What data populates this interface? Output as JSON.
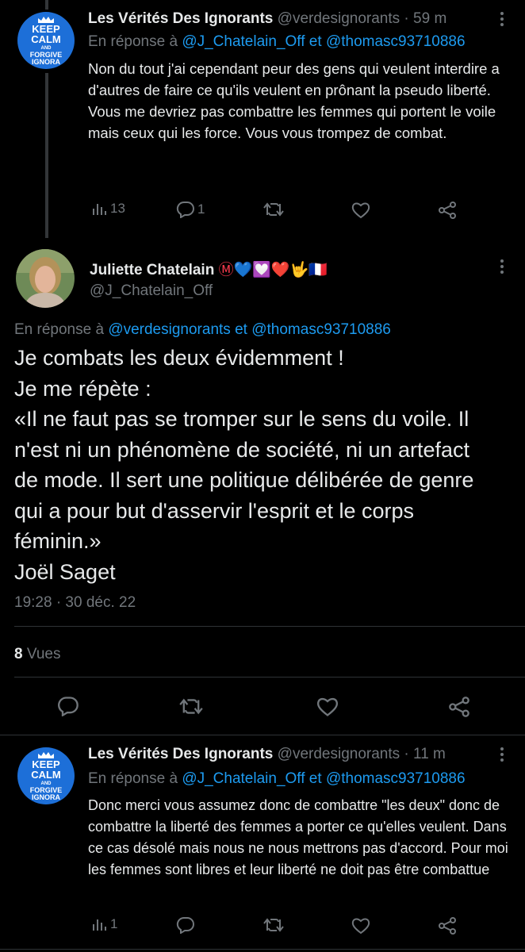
{
  "tweet1": {
    "author_name": "Les Vérités Des Ignorants",
    "handle": "@verdesignorants",
    "sep": "·",
    "time": "59 m",
    "reply_prefix": "En réponse à",
    "reply_to_1": "@J_Chatelain_Off",
    "reply_and": "et",
    "reply_to_2": "@thomasc93710886",
    "text": "Non du tout j'ai cependant peur des gens qui veulent interdire a d'autres de faire ce qu'ils veulent en prônant la pseudo liberté.\nVous me devriez pas combattre les femmes qui portent le voile mais ceux qui les force. Vous vous trompez de combat.",
    "views": "13",
    "replies": "1",
    "avatar": {
      "l1": "KEEP",
      "l2": "CALM",
      "l3": "AND",
      "l4": "FORGIVE",
      "l5": "IGNORA"
    }
  },
  "tweet2": {
    "author_name": "Juliette Chatelain",
    "badges": "Ⓜ💙💟❤️🤟🇫🇷",
    "handle": "@J_Chatelain_Off",
    "reply_prefix": "En réponse à",
    "reply_to_1": "@verdesignorants",
    "reply_and": "et",
    "reply_to_2": "@thomasc93710886",
    "text": "Je combats les deux évidemment !\nJe me répète :\n«Il ne faut pas se tromper sur le sens du voile. Il n'est ni un phénomène de société, ni un artefact de mode. Il sert une politique délibérée de genre qui a pour but d'asservir l'esprit et le corps féminin.»\nJoël Saget",
    "timestamp": "19:28 · 30 déc. 22",
    "views_count": "8",
    "views_label": "Vues"
  },
  "tweet3": {
    "author_name": "Les Vérités Des Ignorants",
    "handle": "@verdesignorants",
    "sep": "·",
    "time": "11 m",
    "reply_prefix": "En réponse à",
    "reply_to_1": "@J_Chatelain_Off",
    "reply_and": "et",
    "reply_to_2": "@thomasc93710886",
    "text": "Donc merci vous assumez donc de combattre \"les deux\" donc de combattre la liberté des femmes a porter ce qu'elles veulent. Dans ce cas désolé mais nous ne nous mettrons pas d'accord. Pour moi les femmes sont libres et leur liberté ne doit pas être combattue",
    "views": "1",
    "avatar": {
      "l1": "KEEP",
      "l2": "CALM",
      "l3": "AND",
      "l4": "FORGIVE",
      "l5": "IGNORA"
    }
  },
  "colors": {
    "background": "#000000",
    "text": "#e7e9ea",
    "muted": "#71767b",
    "link": "#1d9bf0",
    "avatar_blue": "#1d6fd8"
  }
}
